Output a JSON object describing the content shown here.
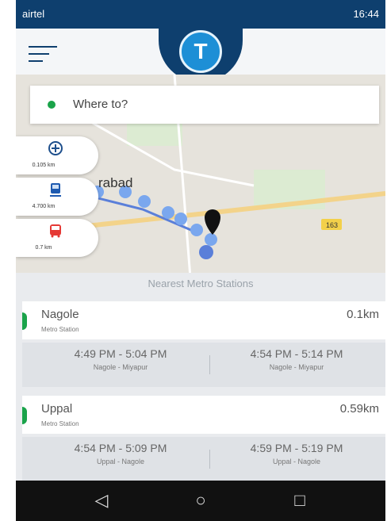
{
  "status_bar": {
    "carrier": "airtel",
    "time": "16:44"
  },
  "search": {
    "placeholder": "Where to?"
  },
  "map": {
    "labels": {
      "city": "rabad",
      "road_badge": "163"
    }
  },
  "transport_options": [
    {
      "icon": "metro-icon",
      "distance": "0.105 km"
    },
    {
      "icon": "train-icon",
      "distance": "4.700 km"
    },
    {
      "icon": "bus-icon",
      "distance": "0.7 km"
    }
  ],
  "panel": {
    "title": "Nearest Metro Stations"
  },
  "stations": [
    {
      "name": "Nagole",
      "distance": "0.1km",
      "subtitle": "Metro Station",
      "departures": [
        {
          "time": "4:49 PM - 5:04 PM",
          "route": "Nagole - Miyapur"
        },
        {
          "time": "4:54 PM - 5:14 PM",
          "route": "Nagole - Miyapur"
        }
      ]
    },
    {
      "name": "Uppal",
      "distance": "0.59km",
      "subtitle": "Metro Station",
      "departures": [
        {
          "time": "4:54 PM - 5:09 PM",
          "route": "Uppal - Nagole"
        },
        {
          "time": "4:59 PM - 5:19 PM",
          "route": "Uppal - Nagole"
        }
      ]
    }
  ],
  "nav": {
    "back": "◁",
    "home": "○",
    "recents": "□"
  },
  "colors": {
    "primary": "#0e3f6e",
    "accent": "#1d8fd6",
    "green": "#1aa34a",
    "orange": "#f07d18"
  }
}
